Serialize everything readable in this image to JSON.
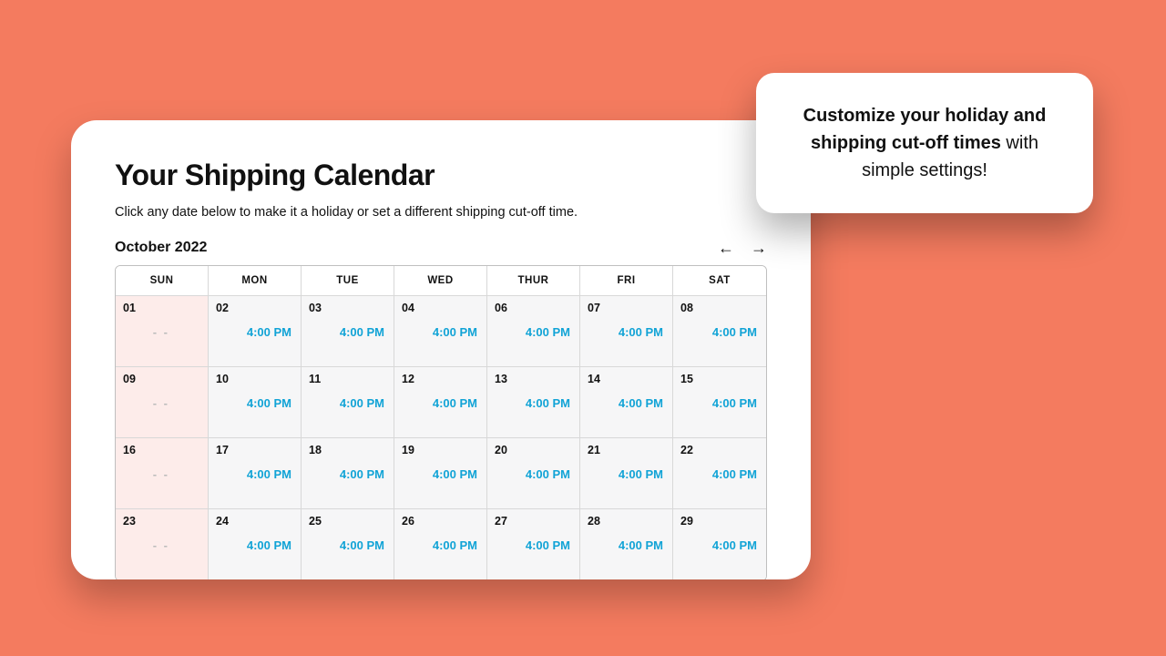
{
  "card": {
    "title": "Your Shipping Calendar",
    "subtitle": "Click any date below to make it a holiday or set a different shipping cut-off time.",
    "month_label": "October 2022",
    "default_time": "4:00 PM",
    "off_label": "- -",
    "dow": [
      "SUN",
      "MON",
      "TUE",
      "WED",
      "THUR",
      "FRI",
      "SAT"
    ],
    "rows": [
      [
        "01",
        "02",
        "03",
        "04",
        "06",
        "07",
        "08"
      ],
      [
        "09",
        "10",
        "11",
        "12",
        "13",
        "14",
        "15"
      ],
      [
        "16",
        "17",
        "18",
        "19",
        "20",
        "21",
        "22"
      ],
      [
        "23",
        "24",
        "25",
        "26",
        "27",
        "28",
        "29"
      ]
    ]
  },
  "tooltip": {
    "bold": "Customize your holiday and shipping cut-off times",
    "rest": " with simple settings!"
  },
  "colors": {
    "background": "#f47b5f",
    "time": "#11a3d6",
    "sunday_bg": "#fdecea"
  }
}
